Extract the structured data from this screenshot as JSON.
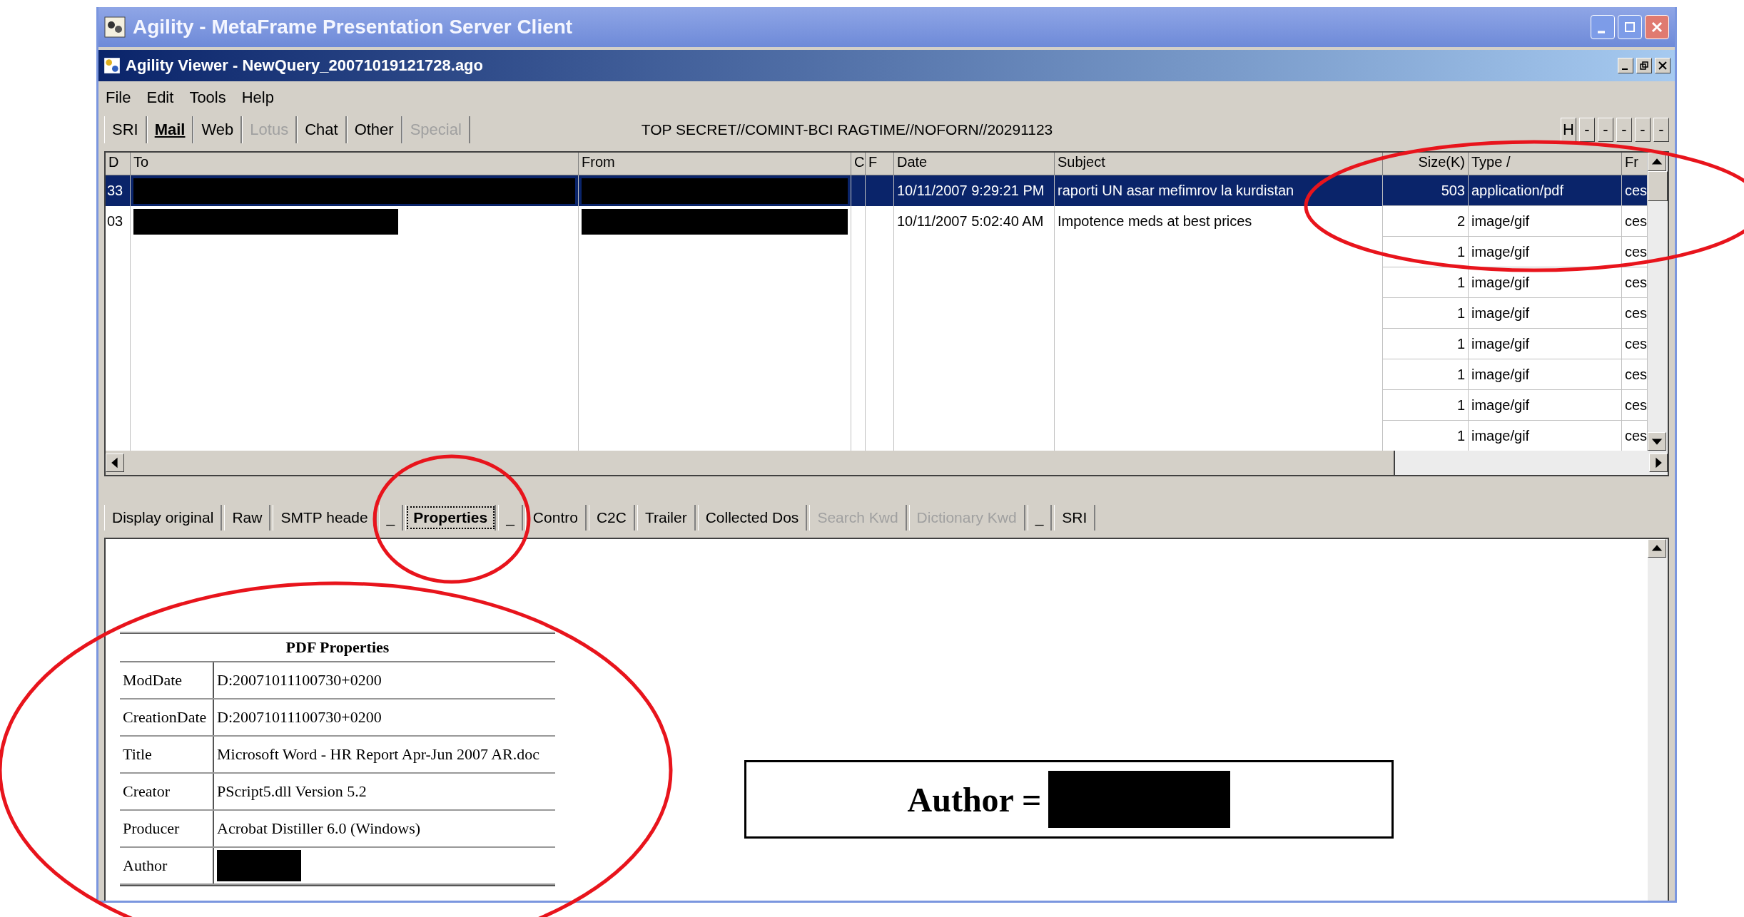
{
  "window": {
    "title": "Agility - MetaFrame Presentation Server Client"
  },
  "viewer": {
    "title": "Agility Viewer - NewQuery_20071019121728.ago"
  },
  "menu": [
    "File",
    "Edit",
    "Tools",
    "Help"
  ],
  "source_tabs": [
    {
      "label": "SRI",
      "selected": false,
      "disabled": false
    },
    {
      "label": "Mail",
      "selected": true,
      "disabled": false
    },
    {
      "label": "Web",
      "selected": false,
      "disabled": false
    },
    {
      "label": "Lotus",
      "selected": false,
      "disabled": true
    },
    {
      "label": "Chat",
      "selected": false,
      "disabled": false
    },
    {
      "label": "Other",
      "selected": false,
      "disabled": false
    },
    {
      "label": "Special",
      "selected": false,
      "disabled": true
    }
  ],
  "classification": "TOP SECRET//COMINT-BCI RAGTIME//NOFORN//20291123",
  "toolbar_buttons": [
    "H",
    "-",
    "-",
    "-",
    "-",
    "-"
  ],
  "table": {
    "columns": [
      "D",
      "To",
      "From",
      "C",
      "F",
      "Date",
      "Subject",
      "Size(K)",
      "Type /",
      "Fr"
    ],
    "rows": [
      {
        "selected": true,
        "id": "33",
        "to_redacted": true,
        "from_redacted": true,
        "date": "10/11/2007 9:29:21 PM",
        "subject": "raporti UN asar mefimrov la kurdistan",
        "size": "503",
        "type": "application/pdf",
        "fr": "ces"
      },
      {
        "selected": false,
        "id": "03",
        "to_redacted": true,
        "from_redacted": true,
        "date": "10/11/2007 5:02:40 AM",
        "subject": "Impotence meds at best prices",
        "size": "2",
        "type": "image/gif",
        "fr": "ces"
      },
      {
        "selected": false,
        "size": "1",
        "type": "image/gif",
        "fr": "ces"
      },
      {
        "selected": false,
        "size": "1",
        "type": "image/gif",
        "fr": "ces"
      },
      {
        "selected": false,
        "size": "1",
        "type": "image/gif",
        "fr": "ces"
      },
      {
        "selected": false,
        "size": "1",
        "type": "image/gif",
        "fr": "ces"
      },
      {
        "selected": false,
        "size": "1",
        "type": "image/gif",
        "fr": "ces"
      },
      {
        "selected": false,
        "size": "1",
        "type": "image/gif",
        "fr": "ces"
      },
      {
        "selected": false,
        "size": "1",
        "type": "image/gif",
        "fr": "ces"
      }
    ]
  },
  "view_tabs": [
    {
      "label": "Display original",
      "selected": false,
      "disabled": false
    },
    {
      "label": "Raw",
      "selected": false,
      "disabled": false
    },
    {
      "label": "SMTP heade",
      "selected": false,
      "disabled": false
    },
    {
      "label": "_",
      "selected": false,
      "disabled": false
    },
    {
      "label": "Properties",
      "selected": true,
      "disabled": false
    },
    {
      "label": "_",
      "selected": false,
      "disabled": false
    },
    {
      "label": "Contro",
      "selected": false,
      "disabled": false
    },
    {
      "label": "C2C",
      "selected": false,
      "disabled": false
    },
    {
      "label": "Trailer",
      "selected": false,
      "disabled": false
    },
    {
      "label": "Collected Dos",
      "selected": false,
      "disabled": false
    },
    {
      "label": "Search Kwd",
      "selected": false,
      "disabled": true
    },
    {
      "label": "Dictionary Kwd",
      "selected": false,
      "disabled": true
    },
    {
      "label": "_",
      "selected": false,
      "disabled": false
    },
    {
      "label": "SRI",
      "selected": false,
      "disabled": false
    }
  ],
  "properties": {
    "title": "PDF Properties",
    "rows": [
      {
        "key": "ModDate",
        "value": "D:20071011100730+0200",
        "redacted": false
      },
      {
        "key": "CreationDate",
        "value": "D:20071011100730+0200",
        "redacted": false
      },
      {
        "key": "Title",
        "value": "Microsoft Word - HR Report Apr-Jun 2007 AR.doc",
        "redacted": false
      },
      {
        "key": "Creator",
        "value": "PScript5.dll Version 5.2",
        "redacted": false
      },
      {
        "key": "Producer",
        "value": "Acrobat Distiller 6.0 (Windows)",
        "redacted": false
      },
      {
        "key": "Author",
        "redacted": true
      }
    ]
  },
  "callout": {
    "label": "Author =",
    "redacted": true
  },
  "annotations": [
    {
      "kind": "ellipse"
    },
    {
      "kind": "ellipse"
    },
    {
      "kind": "ellipse"
    }
  ]
}
